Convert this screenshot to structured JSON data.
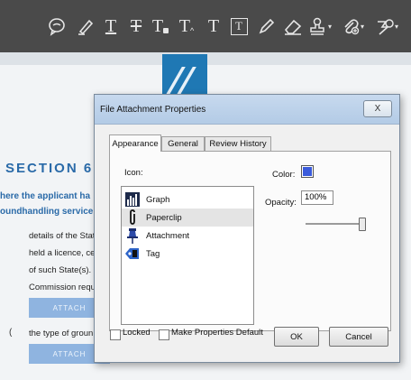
{
  "toolbar": {
    "tools": [
      {
        "icon": "comment-icon"
      },
      {
        "icon": "highlight-pen-icon"
      },
      {
        "icon": "underline-text-icon",
        "glyph": "T"
      },
      {
        "icon": "strikethrough-text-icon",
        "glyph": "T"
      },
      {
        "icon": "replace-text-icon",
        "glyph": "T"
      },
      {
        "icon": "insert-text-icon",
        "glyph": "T"
      },
      {
        "icon": "add-text-icon",
        "glyph": "T"
      },
      {
        "icon": "text-box-icon",
        "glyph": "T"
      },
      {
        "icon": "pencil-icon"
      },
      {
        "icon": "eraser-icon"
      },
      {
        "icon": "stamp-icon"
      },
      {
        "icon": "attach-file-icon"
      },
      {
        "icon": "shapes-icon"
      }
    ]
  },
  "document": {
    "section_heading": "SECTION 6",
    "lines": [
      "here the applicant ha",
      "oundhandling service"
    ],
    "body_lines": [
      "details of the State",
      "held a licence, cer",
      "of such State(s). Pl",
      "Commission requ"
    ],
    "attach_label": "ATTACH",
    "line_2": "the type of groun",
    "colors": {
      "heading": "#2a6aa8",
      "attach_button": "#8fb4e0"
    }
  },
  "dialog": {
    "title": "File Attachment Properties",
    "close_label": "X",
    "tabs": [
      "Appearance",
      "General",
      "Review History"
    ],
    "active_tab": "Appearance",
    "icon_label": "Icon:",
    "icons": [
      {
        "label": "Graph",
        "icon": "graph-icon"
      },
      {
        "label": "Paperclip",
        "icon": "paperclip-icon",
        "selected": true
      },
      {
        "label": "Attachment",
        "icon": "pushpin-icon"
      },
      {
        "label": "Tag",
        "icon": "tag-icon"
      }
    ],
    "color_label": "Color:",
    "color_value": "#3b5bdb",
    "opacity_label": "Opacity:",
    "opacity_value": "100%",
    "locked_label": "Locked",
    "make_default_label": "Make Properties Default",
    "ok_label": "OK",
    "cancel_label": "Cancel"
  }
}
